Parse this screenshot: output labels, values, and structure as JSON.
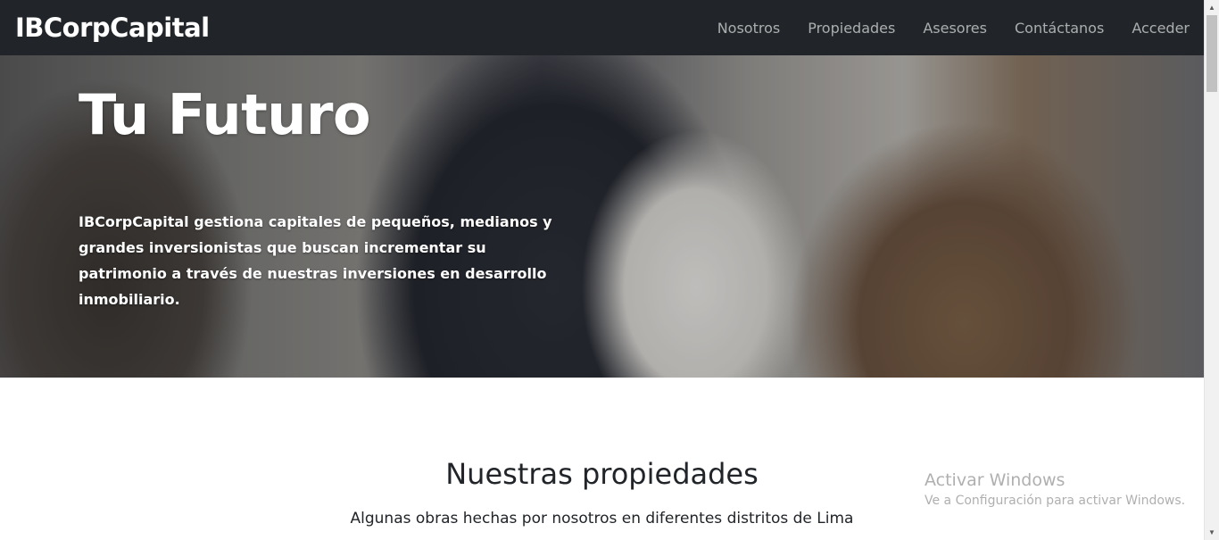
{
  "navbar": {
    "brand": "IBCorpCapital",
    "links": [
      "Nosotros",
      "Propiedades",
      "Asesores",
      "Contáctanos",
      "Acceder"
    ]
  },
  "hero": {
    "title": "Tu Futuro",
    "description": "IBCorpCapital gestiona capitales de pequeños, medianos y grandes inversionistas que buscan incrementar su patrimonio a través de nuestras inversiones en desarrollo inmobiliario."
  },
  "properties": {
    "title": "Nuestras propiedades",
    "subtitle": "Algunas obras hechas por nosotros en diferentes distritos de Lima"
  },
  "watermark": {
    "title": "Activar Windows",
    "subtitle": "Ve a Configuración para activar Windows."
  },
  "colors": {
    "navbar_bg": "#212529",
    "nav_link": "rgba(255,255,255,0.62)",
    "text_dark": "#212529"
  }
}
